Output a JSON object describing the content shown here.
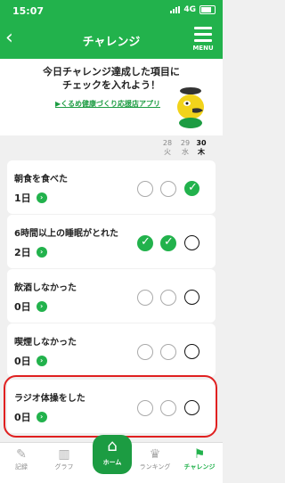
{
  "status": {
    "time": "15:07",
    "network": "4G"
  },
  "header": {
    "back": "‹",
    "title": "チャレンジ",
    "menu": "MENU"
  },
  "hero": {
    "line1": "今日チャレンジ達成した項目に",
    "line2": "チェックを入れよう！",
    "link": "▶くるめ健康づくり応援店アプリ"
  },
  "dates": [
    {
      "day": "28",
      "wd": "火"
    },
    {
      "day": "29",
      "wd": "水"
    },
    {
      "day": "30",
      "wd": "木"
    }
  ],
  "challenges": [
    {
      "name": "朝食を食べた",
      "days": "1日",
      "done": [
        false,
        false,
        true
      ]
    },
    {
      "name": "6時間以上の睡眠がとれた",
      "days": "2日",
      "done": [
        true,
        true,
        false
      ]
    },
    {
      "name": "飲酒しなかった",
      "days": "0日",
      "done": [
        false,
        false,
        false
      ]
    },
    {
      "name": "喫煙しなかった",
      "days": "0日",
      "done": [
        false,
        false,
        false
      ]
    },
    {
      "name": "ラジオ体操をした",
      "days": "0日",
      "done": [
        false,
        false,
        false
      ]
    }
  ],
  "tabs": {
    "record": "記録",
    "graph": "グラフ",
    "home": "ホーム",
    "ranking": "ランキング",
    "challenge": "チャレンジ"
  },
  "colors": {
    "primary": "#22b24c",
    "highlight": "#e02020"
  }
}
